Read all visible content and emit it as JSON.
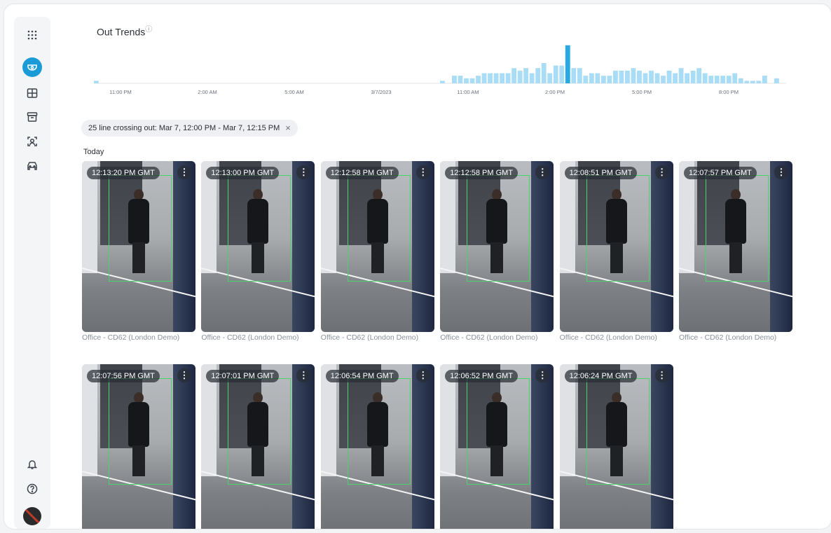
{
  "trends": {
    "title": "Out Trends",
    "help_mark": "?"
  },
  "chart_data": {
    "type": "bar",
    "title": "Out Trends",
    "x_ticks": [
      "11:00 PM",
      "2:00 AM",
      "5:00 AM",
      "3/7/2023",
      "11:00 AM",
      "2:00 PM",
      "5:00 PM",
      "8:00 PM"
    ],
    "values": [
      1,
      0,
      0,
      0,
      0,
      0,
      0,
      0,
      0,
      0,
      0,
      0,
      0,
      0,
      0,
      0,
      0,
      0,
      0,
      0,
      0,
      0,
      0,
      0,
      0,
      0,
      0,
      0,
      0,
      0,
      0,
      0,
      0,
      0,
      0,
      0,
      0,
      0,
      0,
      0,
      0,
      0,
      0,
      0,
      0,
      0,
      0,
      0,
      0,
      0,
      0,
      0,
      0,
      0,
      0,
      0,
      0,
      0,
      1,
      0,
      3,
      3,
      2,
      2,
      3,
      4,
      4,
      4,
      4,
      4,
      6,
      5,
      6,
      4,
      6,
      8,
      4,
      7,
      7,
      15,
      6,
      6,
      3,
      4,
      4,
      3,
      3,
      5,
      5,
      5,
      6,
      5,
      4,
      5,
      4,
      3,
      5,
      4,
      6,
      4,
      5,
      6,
      4,
      3,
      3,
      3,
      3,
      4,
      2,
      1,
      1,
      1,
      3,
      0,
      2,
      0
    ],
    "ylim": [
      0,
      16
    ],
    "color": "#a9dcf5",
    "highlight_color": "#29a8e3",
    "highlight_index": 79
  },
  "filter": {
    "label": "25 line crossing out: Mar 7, 12:00 PM - Mar 7, 12:15 PM",
    "close": "×"
  },
  "section": "Today",
  "colors": {
    "accent": "#1a9bd7",
    "bbox": "#4bd36b"
  },
  "events": [
    {
      "time": "12:13:20 PM GMT",
      "camera": "Office - CD62 (London Demo)"
    },
    {
      "time": "12:13:00 PM GMT",
      "camera": "Office - CD62 (London Demo)"
    },
    {
      "time": "12:12:58 PM GMT",
      "camera": "Office - CD62 (London Demo)"
    },
    {
      "time": "12:12:58 PM GMT",
      "camera": "Office - CD62 (London Demo)"
    },
    {
      "time": "12:08:51 PM GMT",
      "camera": "Office - CD62 (London Demo)"
    },
    {
      "time": "12:07:57 PM GMT",
      "camera": "Office - CD62 (London Demo)"
    },
    {
      "time": "12:07:56 PM GMT",
      "camera": ""
    },
    {
      "time": "12:07:01 PM GMT",
      "camera": ""
    },
    {
      "time": "12:06:54 PM GMT",
      "camera": ""
    },
    {
      "time": "12:06:52 PM GMT",
      "camera": ""
    },
    {
      "time": "12:06:24 PM GMT",
      "camera": ""
    }
  ],
  "more_glyph": "⋮",
  "sidebar": {
    "items": [
      "apps-grid-icon",
      "camera-dome-icon",
      "layout-grid-icon",
      "archive-icon",
      "face-scan-icon",
      "vehicle-icon"
    ],
    "bottom": [
      "bell-icon",
      "help-icon",
      "avatar"
    ]
  }
}
